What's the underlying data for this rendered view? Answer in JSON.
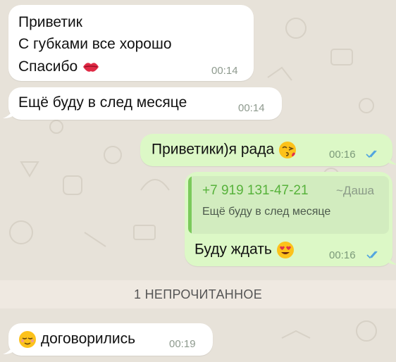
{
  "messages": [
    {
      "lines": [
        "Приветик",
        "С губками все хорошо",
        "Спасибо"
      ],
      "time": "00:14",
      "emoji": "kiss-lips-icon"
    },
    {
      "lines": [
        "Ещё буду в след месяце"
      ],
      "time": "00:14"
    },
    {
      "lines": [
        "Приветики)я рада"
      ],
      "time": "00:16",
      "emoji": "kissing-face-icon",
      "status": "read"
    },
    {
      "quote": {
        "phone": "+7 919 131-47-21",
        "author": "~Даша",
        "text": "Ещё буду в след месяце"
      },
      "lines": [
        "Буду ждать"
      ],
      "time": "00:16",
      "emoji": "heart-eyes-icon",
      "status": "read"
    }
  ],
  "unread_banner": "1 НЕПРОЧИТАННОЕ",
  "last_message": {
    "lines": [
      "договорились"
    ],
    "time": "00:19",
    "emoji": "relieved-face-icon"
  },
  "colors": {
    "wallpaper": "#e7e2d9",
    "incoming": "#ffffff",
    "outgoing": "#dcf8c6",
    "read_ticks": "#4fa3e0",
    "quote_bar": "#7bc95b"
  }
}
